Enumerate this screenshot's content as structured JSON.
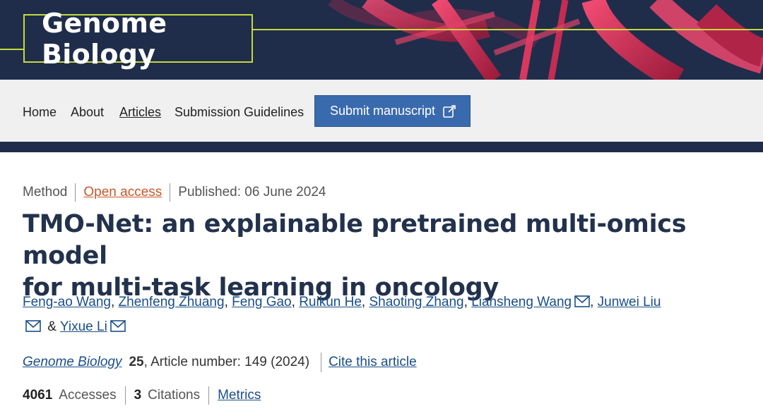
{
  "brand": {
    "logo_text": "Genome Biology",
    "accent": "#c8d83c",
    "navy": "#1f2d4b"
  },
  "nav": {
    "items": [
      {
        "label": "Home",
        "active": false
      },
      {
        "label": "About",
        "active": false
      },
      {
        "label": "Articles",
        "active": true
      },
      {
        "label": "Submission Guidelines",
        "active": false
      }
    ],
    "submit_label": "Submit manuscript",
    "submit_icon": "external-link-icon"
  },
  "article": {
    "type": "Method",
    "access": "Open access",
    "published": "Published: 06 June 2024",
    "title_line1": "TMO-Net: an explainable pretrained multi-omics model",
    "title_line2": "for multi-task learning in oncology",
    "authors": [
      {
        "name": "Feng-ao Wang",
        "corresponding": false
      },
      {
        "name": "Zhenfeng Zhuang",
        "corresponding": false
      },
      {
        "name": "Feng Gao",
        "corresponding": false
      },
      {
        "name": "Ruikun He",
        "corresponding": false
      },
      {
        "name": "Shaoting Zhang",
        "corresponding": false
      },
      {
        "name": "Liansheng Wang",
        "corresponding": true
      },
      {
        "name": "Junwei Liu",
        "corresponding": true
      },
      {
        "name": "Yixue Li",
        "corresponding": true
      }
    ],
    "authors_ampersand": "&",
    "journal_name": "Genome Biology",
    "volume": "25",
    "article_number": ", Article number: 149 (2024)",
    "cite_label": "Cite this article",
    "accesses_count": "4061",
    "accesses_label": "Accesses",
    "citations_count": "3",
    "citations_label": "Citations",
    "metrics_label": "Metrics"
  }
}
